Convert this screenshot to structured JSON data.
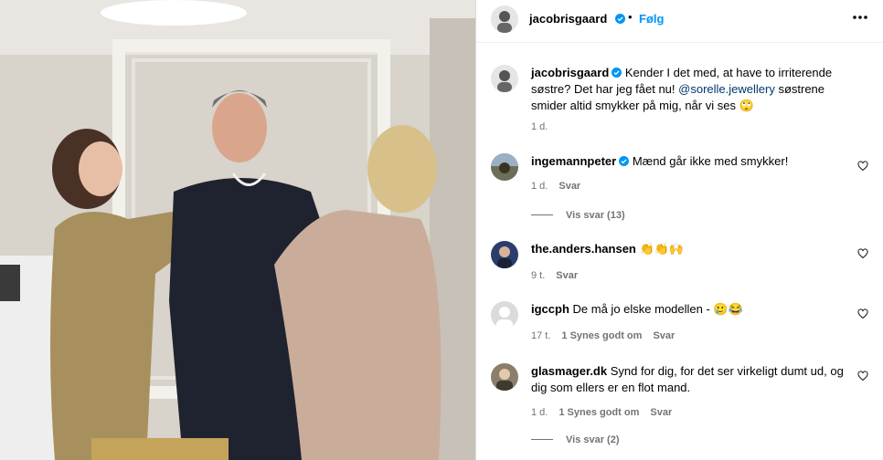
{
  "post": {
    "author": "jacobrisgaard",
    "follow_label": "Følg",
    "more_icon": "more-horizontal-icon",
    "caption_prefix": "Kender I det med, at have to irriterende søstre? Det har jeg fået nu! ",
    "caption_mention": "@sorelle.jewellery",
    "caption_suffix": " søstrene smider altid smykker på mig, når vi ses 🙄",
    "caption_time": "1 d."
  },
  "comments": [
    {
      "user": "ingemannpeter",
      "verified": true,
      "text": "Mænd går ikke med smykker!",
      "time": "1 d.",
      "likes": "",
      "reply": "Svar",
      "view_replies": "Vis svar (13)"
    },
    {
      "user": "the.anders.hansen",
      "verified": false,
      "text": "👏👏🙌",
      "time": "9 t.",
      "likes": "",
      "reply": "Svar",
      "view_replies": ""
    },
    {
      "user": "igccph",
      "verified": false,
      "text": "De må jo elske modellen - 🥲😂",
      "time": "17 t.",
      "likes": "1 Synes godt om",
      "reply": "Svar",
      "view_replies": ""
    },
    {
      "user": "glasmager.dk",
      "verified": false,
      "text": "Synd for dig, for det ser virkeligt dumt ud, og dig som ellers er en flot mand.",
      "time": "1 d.",
      "likes": "1 Synes godt om",
      "reply": "Svar",
      "view_replies": "Vis svar (2)"
    }
  ],
  "colors": {
    "verified_blue": "#0095f6",
    "follow_blue": "#0095f6",
    "mention": "#00376b",
    "muted": "#737373"
  }
}
